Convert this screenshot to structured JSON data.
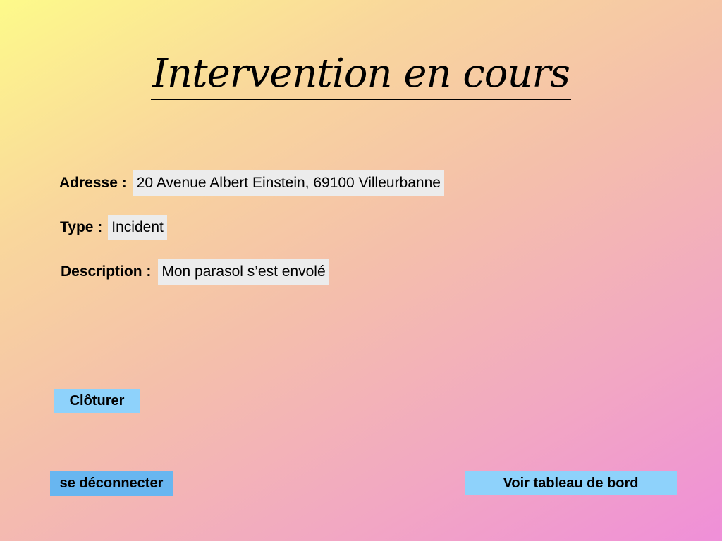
{
  "page": {
    "title": "Intervention en cours"
  },
  "fields": {
    "address": {
      "label": "Adresse :",
      "value": "20 Avenue Albert Einstein, 69100 Villeurbanne"
    },
    "type": {
      "label": "Type :",
      "value": "Incident"
    },
    "description": {
      "label": "Description :",
      "value": "Mon parasol s’est envolé"
    }
  },
  "actions": {
    "close_label": "Clôturer",
    "logout_label": "se déconnecter",
    "dashboard_label": "Voir tableau de bord"
  },
  "colors": {
    "button_primary": "#8ed2fb",
    "button_logout": "#68b6f0",
    "field_background": "#ececec"
  }
}
